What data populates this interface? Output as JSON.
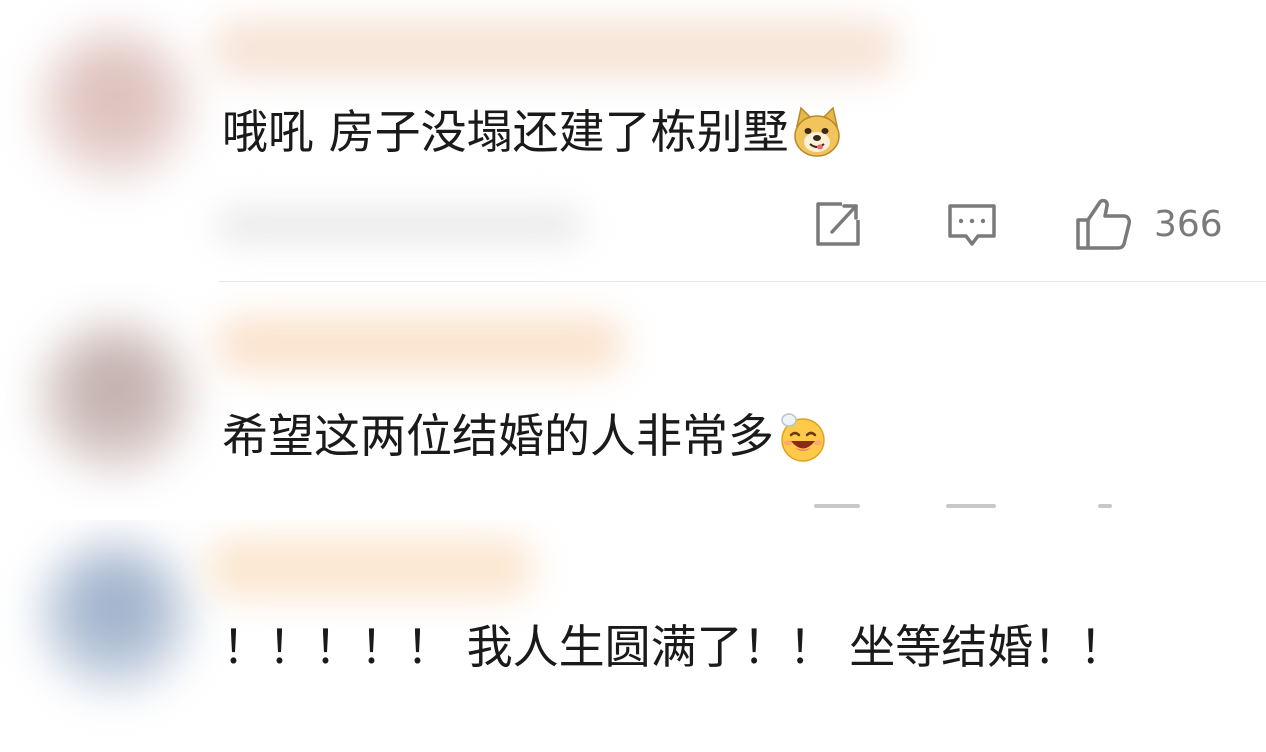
{
  "comments": [
    {
      "text": "哦吼 房子没塌还建了栋别墅",
      "emoji_icon": "doge-emoji-icon",
      "likes": "366"
    },
    {
      "text": "希望这两位结婚的人非常多",
      "emoji_icon": "grinning-emoji-icon"
    },
    {
      "text": "！！！！！ 我人生圆满了！！ 坐等结婚！！"
    }
  ],
  "colors": {
    "text": "#1a1a1a",
    "icon_gray": "#7a7a7a",
    "divider": "#e6e6e6"
  }
}
